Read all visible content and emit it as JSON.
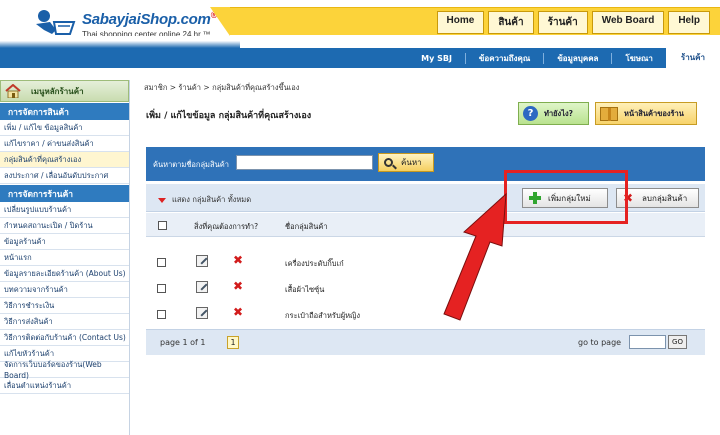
{
  "header": {
    "logo_text": "SabayjaiShop.com",
    "logo_reg": "®",
    "tagline": "Thai shopping center online 24 hr.™",
    "top_nav": [
      "Home",
      "สินค้า",
      "ร้านค้า",
      "Web Board",
      "Help"
    ],
    "sub_nav": [
      "My SBJ",
      "ข้อความถึงคุณ",
      "ข้อมูลบุคคล",
      "โฆษณา",
      "ร้านค้า"
    ]
  },
  "sidebar": {
    "home_label": "เมนูหลักร้านค้า",
    "section1_title": "การจัดการสินค้า",
    "section1_items": [
      "เพิ่ม / แก้ไข ข้อมูลสินค้า",
      "แก้ไขราคา / ค่าขนส่งสินค้า",
      "กลุ่มสินค้าที่คุณสร้างเอง",
      "ลงประกาศ / เลื่อนอันดับประกาศ"
    ],
    "section2_title": "การจัดการร้านค้า",
    "section2_items": [
      "เปลี่ยนรูปแบบร้านค้า",
      "กำหนดสถานะเปิด / ปิดร้าน",
      "ข้อมูลร้านค้า",
      "หน้าแรก",
      "ข้อมูลรายละเอียดร้านค้า (About Us)",
      "บทความจากร้านค้า",
      "วิธีการชำระเงิน",
      "วิธีการส่งสินค้า",
      "วิธีการติดต่อกับร้านค้า (Contact Us)",
      "แก้ไขหัวร้านค้า",
      "จัดการเว็บบอร์ดของร้าน(Web Board)",
      "เลื่อนตำแหน่งร้านค้า"
    ]
  },
  "main": {
    "breadcrumb": "สมาชิก > ร้านค้า > กลุ่มสินค้าที่คุณสร้างขึ้นเอง",
    "title": "เพิ่ม / แก้ไขข้อมูล กลุ่มสินค้าที่คุณสร้างเอง",
    "help_button": "ทำยังไง?",
    "shop_button": "หน้าสินค้าของร้าน",
    "search_label": "ค้นหาตามชื่อกลุ่มสินค้า",
    "search_placeholder": "",
    "search_button": "ค้นหา",
    "show_all": "แสดง กลุ่มสินค้า ทั้งหมด",
    "add_button": "เพิ่มกลุ่มใหม่",
    "delete_button": "ลบกลุ่มสินค้า",
    "columns": [
      "",
      "สิ่งที่คุณต้องการทำ?",
      "ชื่อกลุ่มสินค้า"
    ],
    "rows": [
      {
        "name": "เครื่องประดับกิ๊บเก๋"
      },
      {
        "name": "เสื้อผ้าไซซ์ุน"
      },
      {
        "name": "กระเป๋าถือสำหรับผู้หญิง"
      }
    ],
    "page_info": "page 1 of 1",
    "page_current": "1",
    "goto_label": "go to page",
    "go_button": "GO"
  },
  "colors": {
    "brand_blue": "#1d6ab1",
    "brand_yellow": "#fcd33a",
    "highlight_red": "#e52222"
  },
  "icons": {
    "help": "question-circle-icon",
    "shop": "box-icon",
    "search": "magnifier-icon",
    "add": "plus-icon",
    "delete": "x-icon",
    "edit": "pencil-icon"
  }
}
